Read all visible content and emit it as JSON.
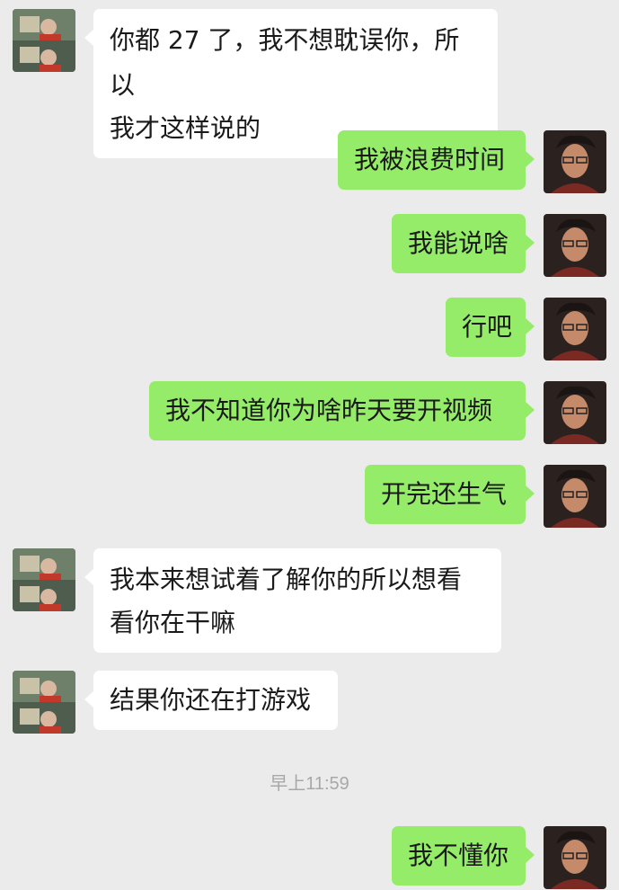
{
  "messages": [
    {
      "side": "left",
      "lines": [
        "你都 27 了，我不想耽误你，所以",
        "我才这样说的"
      ]
    },
    {
      "side": "right",
      "text": "我被浪费时间"
    },
    {
      "side": "right",
      "text": "我能说啥"
    },
    {
      "side": "right",
      "text": "行吧"
    },
    {
      "side": "right",
      "text": "我不知道你为啥昨天要开视频"
    },
    {
      "side": "right",
      "text": "开完还生气"
    },
    {
      "side": "left",
      "lines": [
        "我本来想试着了解你的所以想看",
        "看你在干嘛"
      ]
    },
    {
      "side": "left",
      "text": "结果你还在打游戏"
    },
    {
      "side": "right",
      "text": "我不懂你"
    }
  ],
  "timestamp": "早上11:59",
  "colors": {
    "background": "#ebebeb",
    "sent_bubble": "#95ec69",
    "received_bubble": "#ffffff",
    "timestamp_text": "#a8a8a8"
  },
  "icons": {
    "left_avatar": "contact-avatar-photo",
    "right_avatar": "self-avatar-photo"
  }
}
